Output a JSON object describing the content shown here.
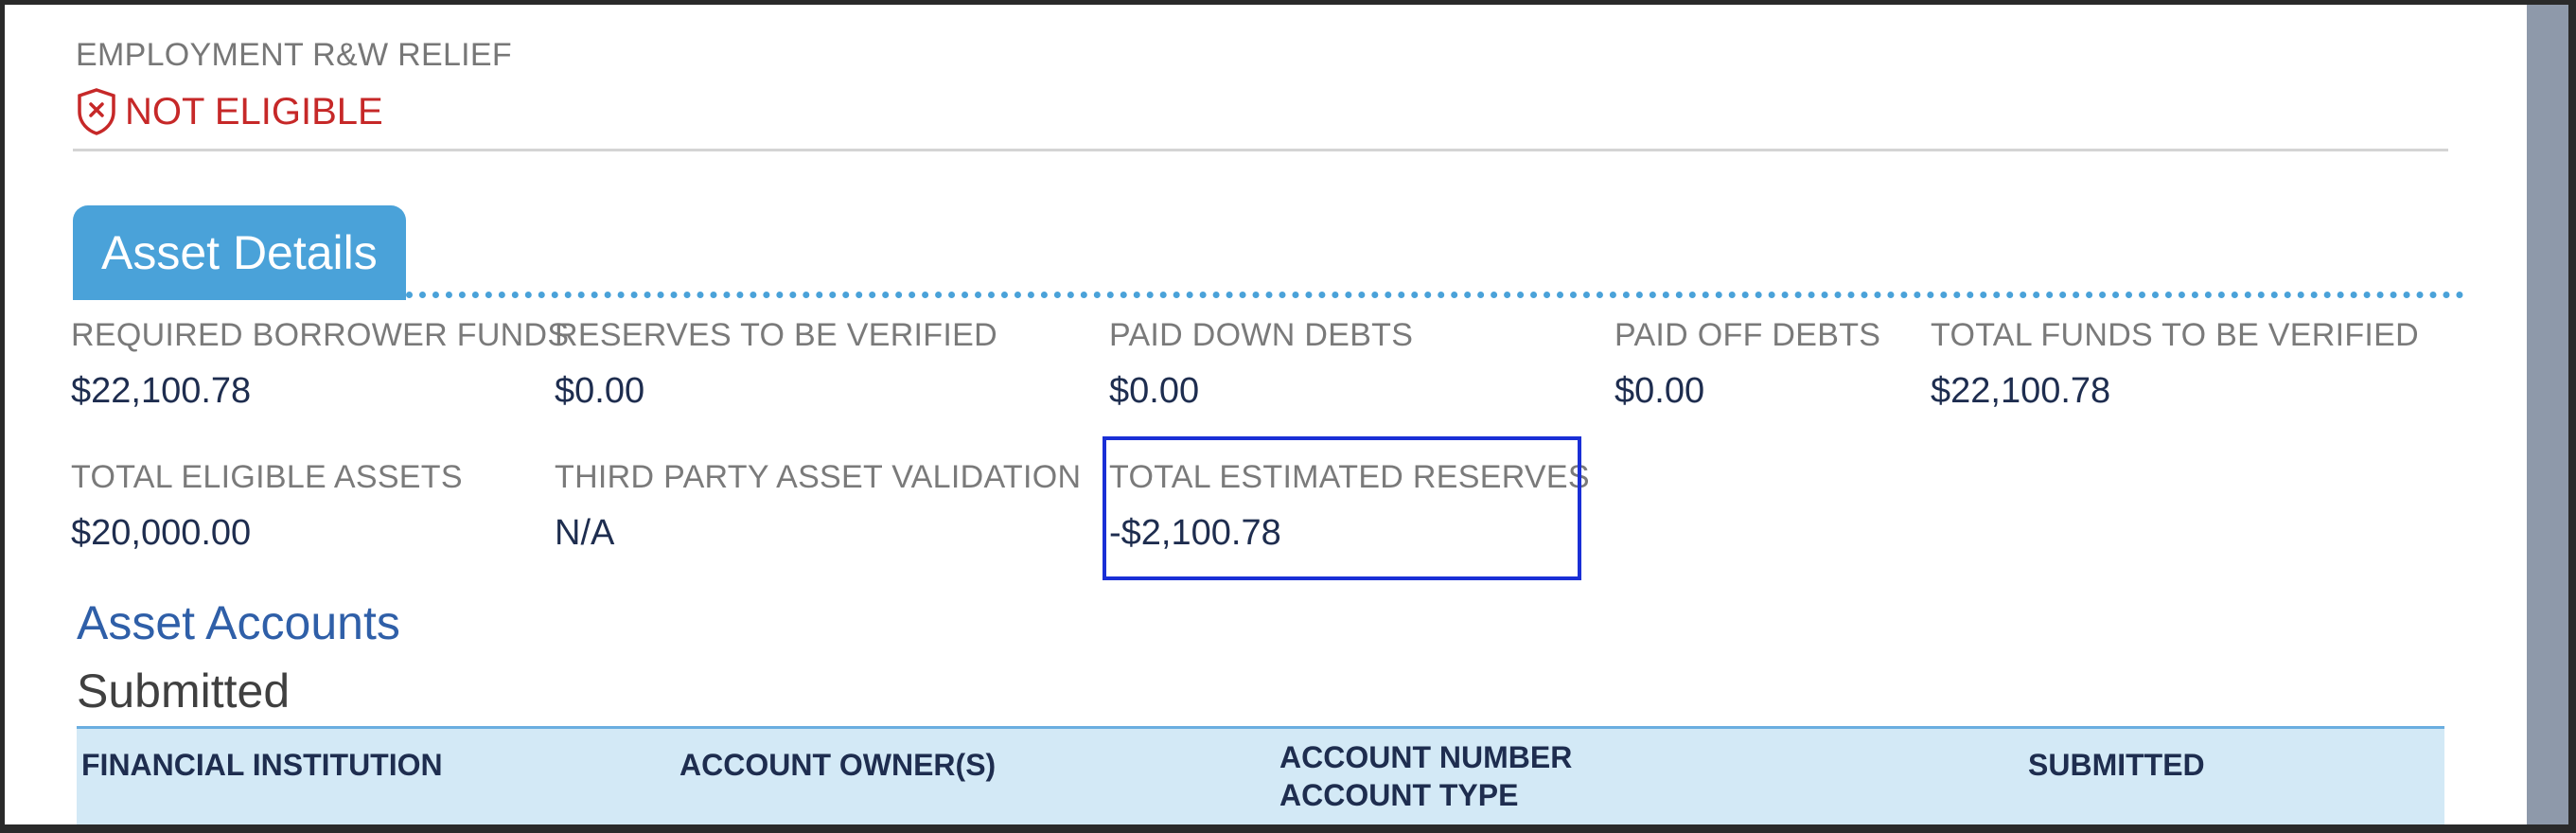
{
  "employment": {
    "label": "EMPLOYMENT R&W RELIEF",
    "status": "NOT ELIGIBLE",
    "status_color": "#c62828",
    "status_icon": "shield-x-icon"
  },
  "asset_details": {
    "tab_label": "Asset Details",
    "fields": [
      {
        "label": "REQUIRED BORROWER FUNDS",
        "value": "$22,100.78"
      },
      {
        "label": "RESERVES TO BE VERIFIED",
        "value": "$0.00"
      },
      {
        "label": "PAID DOWN DEBTS",
        "value": "$0.00"
      },
      {
        "label": "PAID OFF DEBTS",
        "value": "$0.00"
      },
      {
        "label": "TOTAL FUNDS TO BE VERIFIED",
        "value": "$22,100.78"
      },
      {
        "label": "TOTAL ELIGIBLE ASSETS",
        "value": "$20,000.00"
      },
      {
        "label": "THIRD PARTY ASSET VALIDATION",
        "value": "N/A"
      },
      {
        "label": "TOTAL ESTIMATED RESERVES",
        "value": "-$2,100.78"
      }
    ]
  },
  "asset_accounts": {
    "title": "Asset Accounts",
    "subtitle": "Submitted",
    "columns": {
      "financial_institution": "FINANCIAL INSTITUTION",
      "account_owners": "ACCOUNT OWNER(S)",
      "account_number": "ACCOUNT NUMBER",
      "account_type": "ACCOUNT TYPE",
      "submitted": "SUBMITTED"
    }
  },
  "colors": {
    "accent": "#4aa2d9",
    "highlight_border": "#1a2fd6",
    "value_text": "#1e2d4f"
  }
}
